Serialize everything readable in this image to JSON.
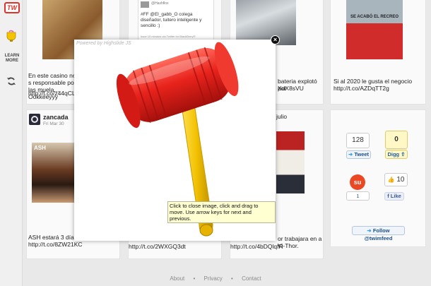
{
  "sidebar": {
    "logo_text": "TW",
    "learn_more": "LEARN MORE",
    "icons": [
      "cup-icon",
      "refresh-icon"
    ]
  },
  "viewer": {
    "powered_by": "Powered by Highslide JS",
    "caption": "Click to close image, click and drag to move. Use arrow keys for next and previous.",
    "close_symbol": "×"
  },
  "cards": {
    "casino_text": "En este casino no s responsable por las muela... Ookkeeyyy",
    "casino_link": "http://t.co/z44qCLW",
    "tweet_author": "@Hashflox",
    "tweet_text": "#FF @El_gabb_O colega diseñador, tuitero inteligente y sencillo :)",
    "tweet_via": "hace 10 minutos via Twitter for BlackBerry®",
    "battery_text": "bateria explotó por",
    "battery_link": "XdX8sVU",
    "recreo_text": "Si al 2020 le gusta el negocio",
    "recreo_link": "http://t.co/AZDqTT2g",
    "book_title": "SE ACABÓ EL RECREO",
    "zancada_user": "zancada",
    "zancada_date": "Fri Mar 30",
    "ash_text": "ASH estará 3 días c",
    "ash_link": "http://t.co/8ZW21KC",
    "mid_link": "http://t.co/2WXGQ3dt",
    "julio_text": "julio",
    "vithor_text": "or trabajara en a Vi-Thor.",
    "vithor_link": "http://t.co/4bDQlqfR"
  },
  "share": {
    "tweet_count": "128",
    "tweet_label": "Tweet",
    "digg_count": "0",
    "digg_label": "Digg",
    "stumble_count": "1",
    "like_count": "10",
    "like_label": "Like",
    "follow_label": "Follow @twimfeed"
  },
  "footer": {
    "about": "About",
    "privacy": "Privacy",
    "contact": "Contact",
    "sep": "•"
  },
  "colors": {
    "accent_red": "#e0322b",
    "link_blue": "#1c5fa8",
    "hammer_red": "#e8231c",
    "hammer_yellow": "#f2c100"
  }
}
